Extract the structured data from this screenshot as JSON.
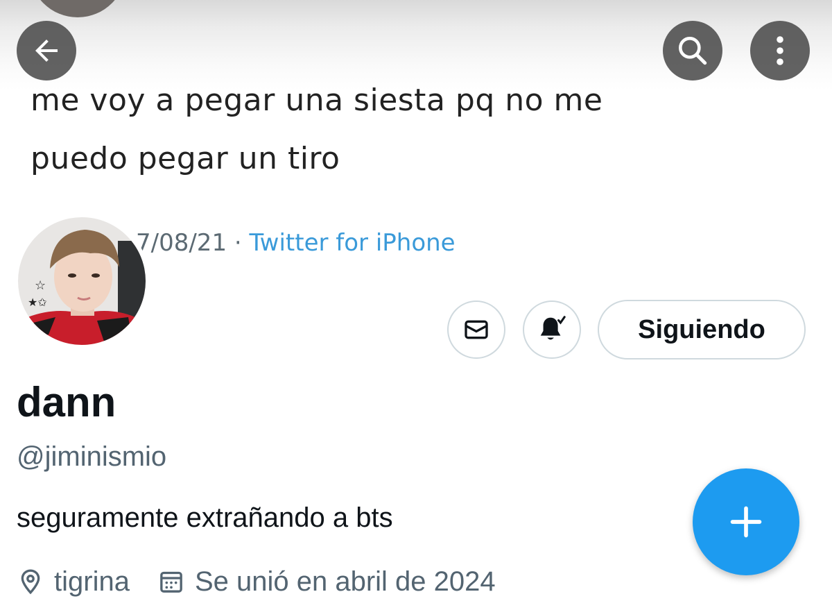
{
  "banner": {
    "tweet_lines": [
      "me voy a pegar una siesta pq no me",
      "puedo pegar un tiro"
    ],
    "date_fragment": "7/08/21",
    "separator": "·",
    "source": "Twitter for iPhone"
  },
  "header": {
    "back_icon": "arrow-left-icon",
    "search_icon": "search-icon",
    "more_icon": "more-vertical-icon"
  },
  "actions": {
    "message_icon": "mail-icon",
    "notifications_icon": "bell-check-icon",
    "follow_label": "Siguiendo"
  },
  "profile": {
    "display_name": "dann",
    "handle": "@jiminismio",
    "bio": "seguramente extrañando a bts",
    "location": "tigrina",
    "joined": "Se unió en abril de 2024"
  },
  "fab": {
    "icon": "plus-icon"
  },
  "colors": {
    "accent": "#1d9bf0",
    "text_primary": "#0f1419",
    "text_secondary": "#536471",
    "border": "#cfd9de"
  }
}
